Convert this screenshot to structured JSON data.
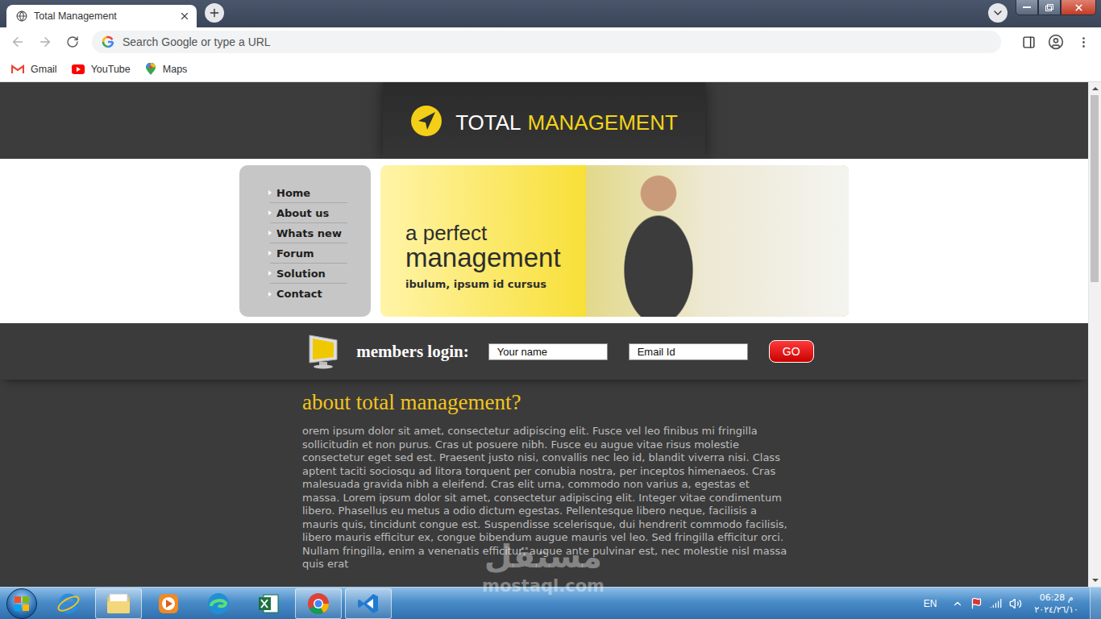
{
  "window": {
    "title": "Total Management"
  },
  "tabs": [
    {
      "label": "Total Management",
      "selected": true
    }
  ],
  "address_bar": {
    "placeholder": "Search Google or type a URL"
  },
  "bookmarks": [
    {
      "label": "Gmail",
      "kind": "gmail"
    },
    {
      "label": "YouTube",
      "kind": "youtube"
    },
    {
      "label": "Maps",
      "kind": "maps"
    }
  ],
  "site": {
    "logo": {
      "first": "TOTAL",
      "second": "MANAGEMENT"
    },
    "nav": [
      {
        "label": "Home"
      },
      {
        "label": "About us"
      },
      {
        "label": "Whats new"
      },
      {
        "label": "Forum"
      },
      {
        "label": "Solution"
      },
      {
        "label": "Contact"
      }
    ],
    "banner": {
      "line1": "a perfect",
      "line2": "management",
      "tagline": "ibulum, ipsum id cursus"
    },
    "login": {
      "label": "members login:",
      "fields": [
        {
          "placeholder": "Your name"
        },
        {
          "placeholder": "Email Id"
        }
      ],
      "button": "GO"
    },
    "about": {
      "heading": "about total management?",
      "body": "orem ipsum dolor sit amet, consectetur adipiscing elit. Fusce vel leo finibus mi fringilla sollicitudin et non purus. Cras ut posuere nibh. Fusce eu augue vitae risus molestie consectetur eget sed est. Praesent justo nisi, convallis nec leo id, blandit viverra nisi. Class aptent taciti sociosqu ad litora torquent per conubia nostra, per inceptos himenaeos. Cras malesuada gravida nibh a eleifend. Cras elit urna, commodo non varius a, egestas et massa. Lorem ipsum dolor sit amet, consectetur adipiscing elit. Integer vitae condimentum libero. Phasellus eu metus a odio dictum egestas. Pellentesque libero neque, facilisis a mauris quis, tincidunt congue est. Suspendisse scelerisque, dui hendrerit commodo facilisis, libero mauris efficitur ex, congue bibendum augue mauris vel leo. Sed fringilla efficitur orci. Nullam fringilla, enim a venenatis efficitur, augue ante pulvinar est, nec molestie nisl massa quis erat"
    }
  },
  "scrollbar": {
    "level": 0.39
  },
  "taskbar": {
    "apps": [
      {
        "kind": "ie",
        "running": false
      },
      {
        "kind": "explorer",
        "running": true
      },
      {
        "kind": "media",
        "running": false
      },
      {
        "kind": "edge",
        "running": false
      },
      {
        "kind": "excel",
        "running": false
      },
      {
        "kind": "chrome",
        "running": true
      },
      {
        "kind": "vscode",
        "running": true
      }
    ],
    "language": "EN",
    "time": "06:28 م",
    "date": "٢٠٢٤/٢٦/١٠"
  },
  "watermark": {
    "arabic": "مستقل",
    "latin": "mostaql.com"
  }
}
